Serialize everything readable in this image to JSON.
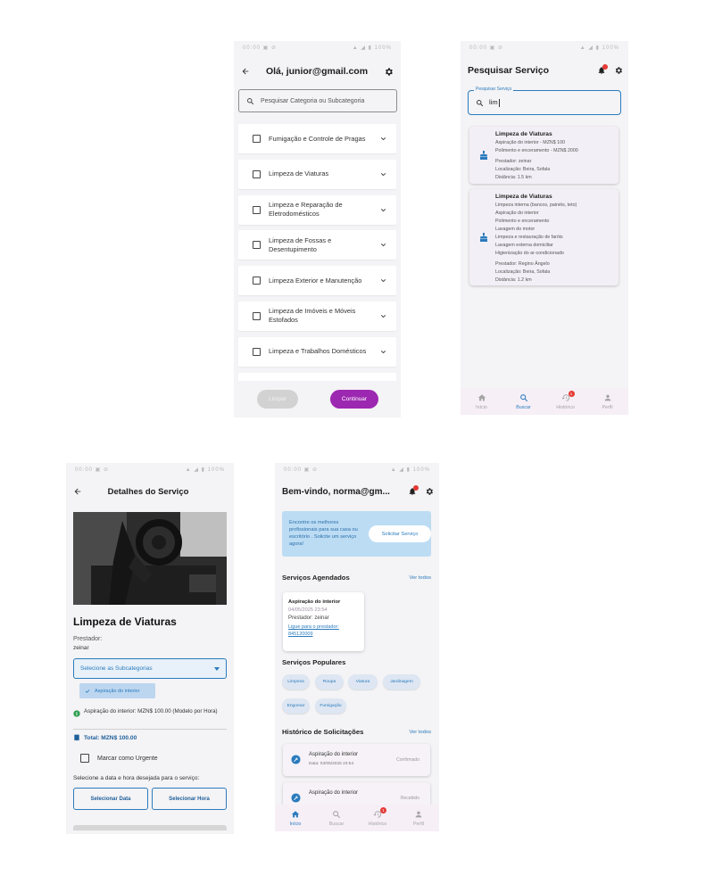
{
  "screen1": {
    "status_left": "00:00 ▣ ⊘",
    "status_right": "▲ ◢ ▮ 100%",
    "title": "Olá, junior@gmail.com",
    "search_placeholder": "Pesquisar Categoria ou Subcategoria",
    "categories": [
      "Fumigação e Controle de Pragas",
      "Limpeza de Viaturas",
      "Limpeza e Reparação de Eletrodomésticos",
      "Limpeza de Fossas e Desentupimento",
      "Limpeza Exterior e Manutenção",
      "Limpeza de Imóveis e Móveis Estofados",
      "Limpeza e Trabalhos Domésticos"
    ],
    "clear_label": "Limpar",
    "continue_label": "Continuar",
    "accent": "#9c27b0"
  },
  "screen2": {
    "status_left": "00:00 ▣ ⊘",
    "status_right": "▲ ◢ ▮ 100%",
    "title": "Pesquisar Serviço",
    "search_label": "Pesquisar Serviço",
    "search_value": "lim",
    "results": [
      {
        "title": "Limpeza de Viaturas",
        "subs": [
          "Aspiração do interior - MZN$ 100",
          "Polimento e enceramento - MZN$ 2000"
        ],
        "prestador": "Prestador: zeinar",
        "localizacao": "Localização: Beira, Sofala",
        "distancia": "Distância: 1.5 km"
      },
      {
        "title": "Limpeza de Viaturas",
        "subs": [
          "Limpeza interna (bancos, painéis, teto)",
          "Aspiração do interior",
          "Polimento e enceramento",
          "Lavagem do motor",
          "Limpeza e restauração de faróis",
          "Lavagem externa domiciliar",
          "Higienização do ar-condicionado"
        ],
        "prestador": "Prestador: Regino Ângelo",
        "localizacao": "Localização: Beira, Sofala",
        "distancia": "Distância: 1.2 km"
      }
    ],
    "nav": [
      {
        "label": "Início",
        "icon": "home-icon"
      },
      {
        "label": "Buscar",
        "icon": "search-icon"
      },
      {
        "label": "Histórico",
        "icon": "history-icon",
        "badge": "1"
      },
      {
        "label": "Perfil",
        "icon": "person-icon"
      }
    ],
    "active_tab": "Buscar"
  },
  "screen3": {
    "status_left": "00:00 ▣ ⊘",
    "status_right": "▲ ◢ ▮ 100%",
    "title": "Detalhes do Serviço",
    "service_name": "Limpeza de Viaturas",
    "prestador_label": "Prestador:",
    "prestador_value": "zeinar",
    "dropdown_label": "Selecione as Subcategorias",
    "selected_chip": "Aspiração do interior",
    "price_line": "Aspiração do interior: MZN$ 100.00 (Modelo por Hora)",
    "total": "Total: MZN$ 100.00",
    "urgent_label": "Marcar como Urgente",
    "date_prompt": "Selecione a data e hora desejada para o serviço:",
    "select_date": "Selecionar Data",
    "select_time": "Selecionar Hora"
  },
  "screen4": {
    "status_left": "00:00 ▣ ⊘",
    "status_right": "▲ ◢ ▮ 100%",
    "title": "Bem-vindo, norma@gm...",
    "banner_text": "Encontre os melhores profissionais para sua casa ou escritório . Solicite um serviço agora!",
    "banner_button": "Solicitar Serviço",
    "scheduled_title": "Serviços Agendados",
    "scheduled_link": "Ver todos",
    "scheduled": {
      "title": "Aspiração do interior",
      "date": "04/05/2025 23:54",
      "prestador": "Prestador: zeinar",
      "call_link": "Ligue para o prestador: 845120009"
    },
    "popular_title": "Serviços Populares",
    "popular": [
      "Limpeza",
      "Roupa",
      "Viatura",
      "Jardinagem",
      "Engomar",
      "Fumigação"
    ],
    "history_title": "Histórico de Solicitações",
    "history_link": "Ver todos",
    "history": [
      {
        "title": "Aspiração do interior",
        "date": "Data: 03/05/2025 23:54",
        "status": "Confirmado"
      },
      {
        "title": "Aspiração do interior",
        "date": "",
        "status": "Recebido"
      }
    ],
    "nav": [
      {
        "label": "Início",
        "icon": "home-icon"
      },
      {
        "label": "Buscar",
        "icon": "search-icon"
      },
      {
        "label": "Histórico",
        "icon": "history-icon",
        "badge": "1"
      },
      {
        "label": "Perfil",
        "icon": "person-icon"
      }
    ],
    "active_tab": "Início"
  }
}
